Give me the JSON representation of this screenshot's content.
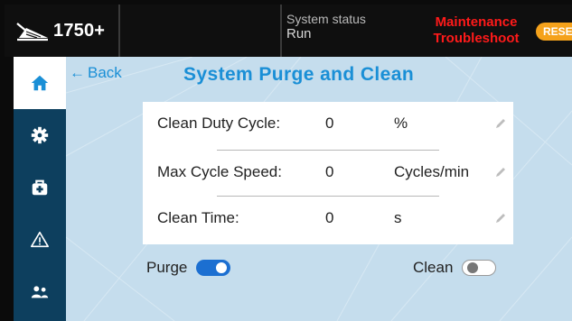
{
  "header": {
    "model": "1750+",
    "status_label": "System status",
    "status_value": "Run",
    "alarm_1": "Maintenance",
    "alarm_2": "Troubleshoot",
    "reset_label": "RESET"
  },
  "sidebar": {
    "items": [
      {
        "icon": "home-icon",
        "active": true
      },
      {
        "icon": "gear-icon",
        "active": false
      },
      {
        "icon": "toolbox-icon",
        "active": false
      },
      {
        "icon": "warning-icon",
        "active": false
      },
      {
        "icon": "users-icon",
        "active": false
      }
    ]
  },
  "page": {
    "back_label": "Back",
    "title": "System Purge and Clean"
  },
  "settings": [
    {
      "label": "Clean Duty Cycle:",
      "value": "0",
      "unit": "%"
    },
    {
      "label": "Max Cycle Speed:",
      "value": "0",
      "unit": "Cycles/min"
    },
    {
      "label": "Clean Time:",
      "value": "0",
      "unit": "s"
    }
  ],
  "toggles": {
    "purge": {
      "label": "Purge",
      "on": true
    },
    "clean": {
      "label": "Clean",
      "on": false
    }
  },
  "colors": {
    "accent": "#1a8fd6",
    "sidebar": "#0d3f5e",
    "alarm": "#ff1a1a",
    "reset": "#f5a21b",
    "toggle_on": "#1c6fd1"
  }
}
